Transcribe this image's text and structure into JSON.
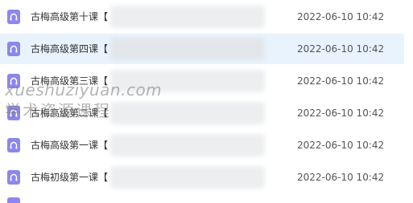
{
  "files": [
    {
      "name": "古梅高级第十课【",
      "date": "2022-06-10 10:42",
      "selected": false
    },
    {
      "name": "古梅高级第四课【",
      "date": "2022-06-10 10:42",
      "selected": true
    },
    {
      "name": "古梅高级第三课【",
      "date": "2022-06-10 10:42",
      "selected": false
    },
    {
      "name": "古梅高级第二课【",
      "date": "2022-06-10 10:42",
      "selected": false
    },
    {
      "name": "古梅高级第一课【",
      "date": "2022-06-10 10:42",
      "selected": false
    },
    {
      "name": "古梅初级第一课【",
      "date": "2022-06-10 10:42",
      "selected": false
    }
  ],
  "watermark": {
    "line1": "xueshuziyuan.com",
    "line2": "学术资源课程"
  },
  "colors": {
    "icon": "#8c86ee",
    "selected_row": "#e8f3fd"
  },
  "icon_name": "audio-file-icon"
}
